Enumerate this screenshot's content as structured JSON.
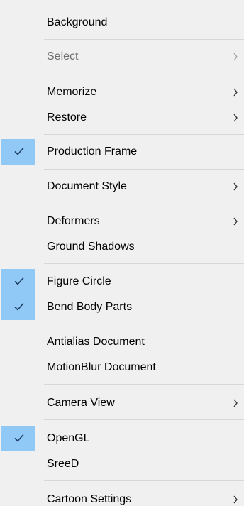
{
  "menu": {
    "items": [
      {
        "label": "Background",
        "checked": false,
        "submenu": false,
        "disabled": false
      },
      {
        "label": "Select",
        "checked": false,
        "submenu": true,
        "disabled": true
      },
      {
        "label": "Memorize",
        "checked": false,
        "submenu": true,
        "disabled": false
      },
      {
        "label": "Restore",
        "checked": false,
        "submenu": true,
        "disabled": false
      },
      {
        "label": "Production Frame",
        "checked": true,
        "submenu": false,
        "disabled": false
      },
      {
        "label": "Document Style",
        "checked": false,
        "submenu": true,
        "disabled": false
      },
      {
        "label": "Deformers",
        "checked": false,
        "submenu": true,
        "disabled": false
      },
      {
        "label": "Ground Shadows",
        "checked": false,
        "submenu": false,
        "disabled": false
      },
      {
        "label": "Figure Circle",
        "checked": true,
        "submenu": false,
        "disabled": false
      },
      {
        "label": "Bend Body Parts",
        "checked": true,
        "submenu": false,
        "disabled": false
      },
      {
        "label": "Antialias Document",
        "checked": false,
        "submenu": false,
        "disabled": false
      },
      {
        "label": "MotionBlur Document",
        "checked": false,
        "submenu": false,
        "disabled": false
      },
      {
        "label": "Camera View",
        "checked": false,
        "submenu": true,
        "disabled": false
      },
      {
        "label": "OpenGL",
        "checked": true,
        "submenu": false,
        "disabled": false
      },
      {
        "label": "SreeD",
        "checked": false,
        "submenu": false,
        "disabled": false
      },
      {
        "label": "Cartoon Settings",
        "checked": false,
        "submenu": true,
        "disabled": false
      }
    ]
  }
}
